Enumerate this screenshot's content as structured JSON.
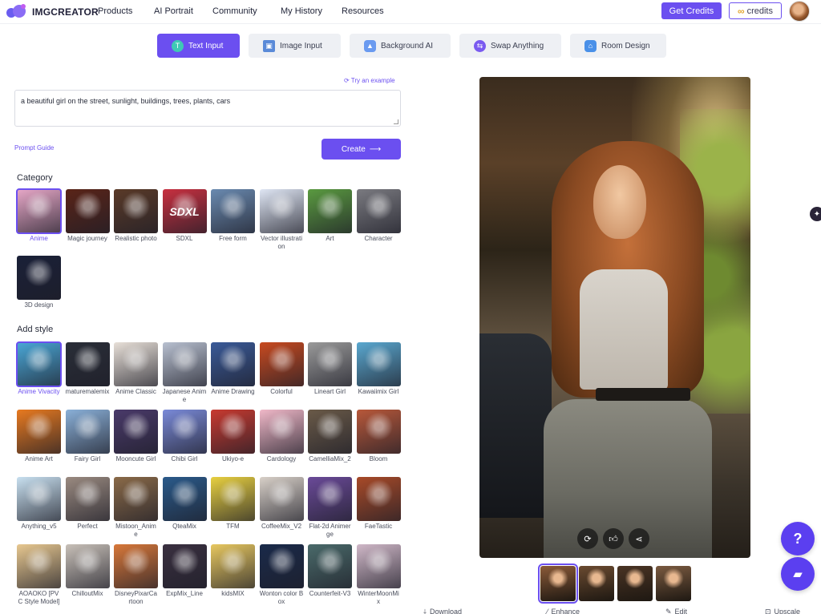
{
  "header": {
    "logo_text": "IMGCREATOR",
    "nav": [
      "Products",
      "AI Portrait",
      "Community",
      "My History",
      "Resources"
    ],
    "get_credits_label": "Get Credits",
    "credits_label": "credits",
    "credits_icon": "∞"
  },
  "tabs": [
    {
      "label": "Text Input",
      "icon": "text-icon",
      "active": true
    },
    {
      "label": "Image Input",
      "icon": "image-icon",
      "active": false
    },
    {
      "label": "Background AI",
      "icon": "mountain-icon",
      "active": false
    },
    {
      "label": "Swap Anything",
      "icon": "swap-icon",
      "active": false
    },
    {
      "label": "Room Design",
      "icon": "house-icon",
      "active": false
    }
  ],
  "prompt": {
    "try_example": "Try an example",
    "value": "a beautiful girl on the street, sunlight, buildings, trees, plants, cars",
    "prompt_guide": "Prompt Guide",
    "create_label": "Create"
  },
  "category": {
    "title": "Category",
    "items": [
      {
        "label": "Anime",
        "selected": true,
        "color": "#e8a8c8"
      },
      {
        "label": "Magic journey",
        "selected": false,
        "color": "#5a2418"
      },
      {
        "label": "Realistic photo",
        "selected": false,
        "color": "#5a3a28"
      },
      {
        "label": "SDXL",
        "selected": false,
        "color": "#c83040",
        "text": "SDXL"
      },
      {
        "label": "Free form",
        "selected": false,
        "color": "#6a8ab0"
      },
      {
        "label": "Vector illustration",
        "selected": false,
        "color": "#dfe6f4"
      },
      {
        "label": "Art",
        "selected": false,
        "color": "#5a9a40"
      },
      {
        "label": "Character",
        "selected": false,
        "color": "#7a7a80"
      },
      {
        "label": "3D design",
        "selected": false,
        "color": "#1a2038"
      }
    ]
  },
  "styles": {
    "title": "Add style",
    "items": [
      {
        "label": "Anime Vivacity",
        "selected": true,
        "color": "#4aa8d8"
      },
      {
        "label": "maturemalemix",
        "selected": false,
        "color": "#2a2e38"
      },
      {
        "label": "Anime Classic",
        "selected": false,
        "color": "#e8e0d8"
      },
      {
        "label": "Japanese Anime",
        "selected": false,
        "color": "#b8c0d0"
      },
      {
        "label": "Anime Drawing",
        "selected": false,
        "color": "#3a5a98"
      },
      {
        "label": "Colorful",
        "selected": false,
        "color": "#c84a20"
      },
      {
        "label": "Lineart Girl",
        "selected": false,
        "color": "#9a9a9a"
      },
      {
        "label": "Kawaiimix Girl",
        "selected": false,
        "color": "#5aa8d0"
      },
      {
        "label": "Anime Art",
        "selected": false,
        "color": "#e87a20"
      },
      {
        "label": "Fairy Girl",
        "selected": false,
        "color": "#8ab0d8"
      },
      {
        "label": "Mooncute Girl",
        "selected": false,
        "color": "#4a3a6a"
      },
      {
        "label": "Chibi Girl",
        "selected": false,
        "color": "#7a8ad8"
      },
      {
        "label": "Ukiyo-e",
        "selected": false,
        "color": "#c83a30"
      },
      {
        "label": "Cardology",
        "selected": false,
        "color": "#f0b8c8"
      },
      {
        "label": "CamelliaMix_2",
        "selected": false,
        "color": "#6a5a48"
      },
      {
        "label": "Bloom",
        "selected": false,
        "color": "#b8583a"
      },
      {
        "label": "Anything_v5",
        "selected": false,
        "color": "#c8e0f0"
      },
      {
        "label": "Perfect",
        "selected": false,
        "color": "#9a8a80"
      },
      {
        "label": "Mistoon_Anime",
        "selected": false,
        "color": "#8a6a48"
      },
      {
        "label": "QteaMix",
        "selected": false,
        "color": "#2a5a8a"
      },
      {
        "label": "TFM",
        "selected": false,
        "color": "#e8d040"
      },
      {
        "label": "CoffeeMix_V2",
        "selected": false,
        "color": "#d8d0c8"
      },
      {
        "label": "Flat-2d Animerge",
        "selected": false,
        "color": "#6a4a98"
      },
      {
        "label": "FaeTastic",
        "selected": false,
        "color": "#a84a28"
      },
      {
        "label": "AOAOKO [PVC Style Model]",
        "selected": false,
        "color": "#e8c890"
      },
      {
        "label": "ChilloutMix",
        "selected": false,
        "color": "#c8c0b8"
      },
      {
        "label": "DisneyPixarCartoon",
        "selected": false,
        "color": "#d8783a"
      },
      {
        "label": "ExpMix_Line",
        "selected": false,
        "color": "#3a3040"
      },
      {
        "label": "kidsMIX",
        "selected": false,
        "color": "#e8c860"
      },
      {
        "label": "Wonton color Box",
        "selected": false,
        "color": "#1a2a4a"
      },
      {
        "label": "Counterfeit-V3",
        "selected": false,
        "color": "#4a6a6a"
      },
      {
        "label": "WinterMoonMix",
        "selected": false,
        "color": "#d0b8c8"
      }
    ]
  },
  "result": {
    "thumbnails": [
      {
        "selected": true,
        "color": "#8a5a38"
      },
      {
        "selected": false,
        "color": "#6a4a30"
      },
      {
        "selected": false,
        "color": "#4a3424"
      },
      {
        "selected": false,
        "color": "#7a5a40"
      }
    ],
    "actions": [
      "Download",
      "Enhance",
      "Edit",
      "Upscale"
    ]
  },
  "colors": {
    "accent": "#6b4ff0",
    "tab_inactive": "#eef0f4"
  }
}
